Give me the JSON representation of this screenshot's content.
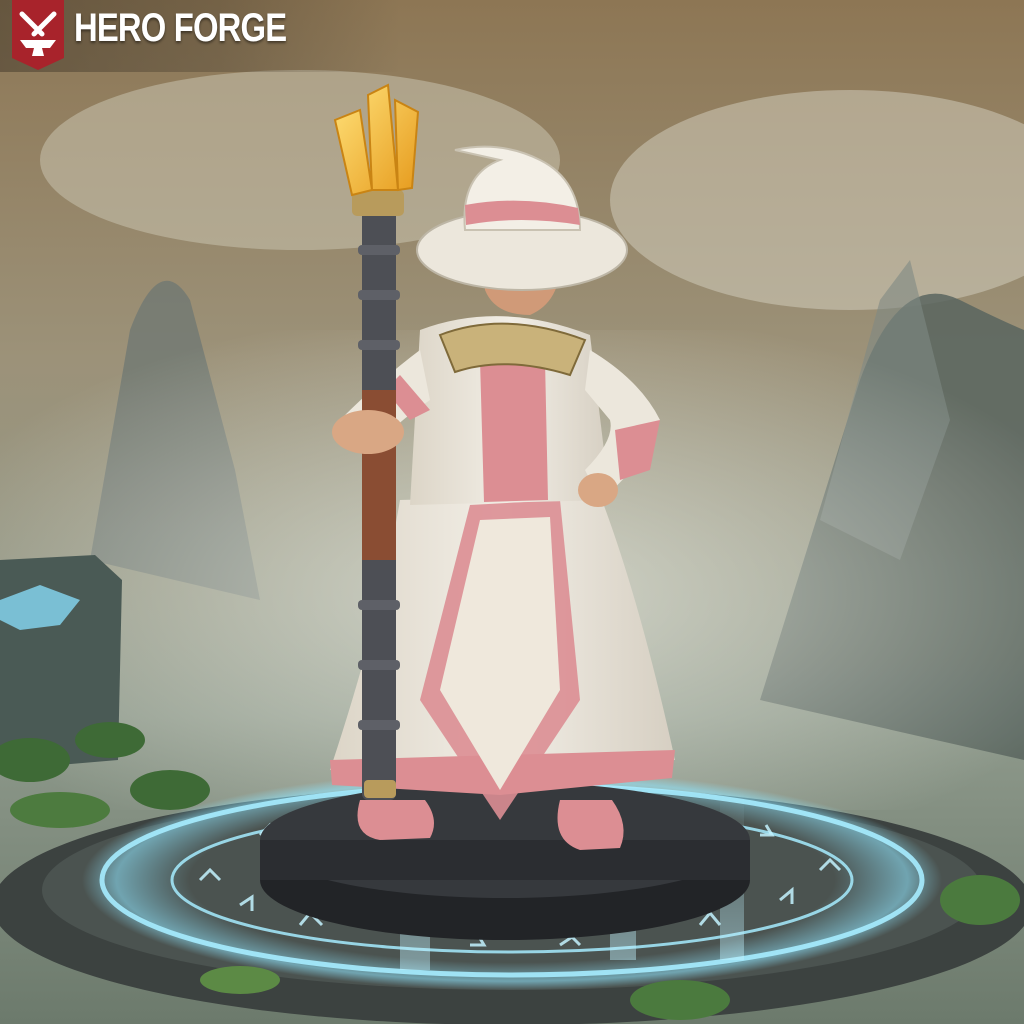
{
  "header": {
    "brand_name": "HERO FORGE",
    "logo_icon": "anvil-and-hammers-icon",
    "logo_color": "#a8232b"
  },
  "scene": {
    "subject": "wizard-miniature",
    "hat_color": "#ece7dc",
    "robe_color": "#ece7dc",
    "trim_color": "#dc8e93",
    "collar_color": "#c9b27a",
    "staff_crystal_color": "#f2b52c",
    "staff_shaft_color": "#4d4f55",
    "staff_grip_color": "#8a4d33",
    "base_color": "#2f3134",
    "rune_glow_color": "#9fe9ff"
  }
}
